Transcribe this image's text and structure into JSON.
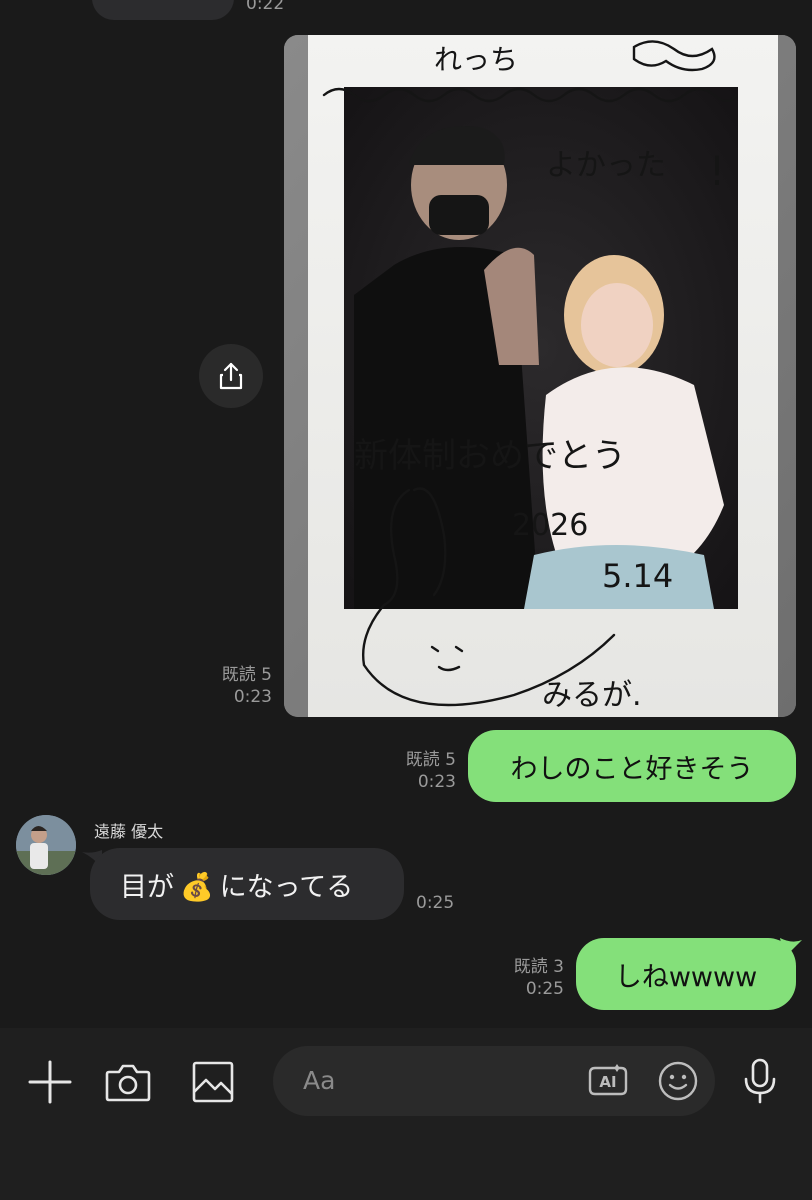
{
  "previous": {
    "time": "0:22"
  },
  "photo_message": {
    "read_receipt": "既読 5",
    "time": "0:23",
    "handwriting": {
      "top": "れっち",
      "middle": "よかった！",
      "center": "新体制おめでとう",
      "year": "2026",
      "date": "5.14",
      "signature": "みるが."
    }
  },
  "messages": [
    {
      "type": "sent",
      "read_receipt": "既読 5",
      "time": "0:23",
      "text": "わしのこと好きそう"
    },
    {
      "type": "received",
      "sender": "遠藤 優太",
      "time": "0:25",
      "text_before": "目が",
      "emoji": "💰",
      "text_after": "になってる"
    },
    {
      "type": "sent",
      "read_receipt": "既読 3",
      "time": "0:25",
      "text": "しねwwww"
    }
  ],
  "composer": {
    "placeholder": "Aa",
    "ai_label": "AI"
  },
  "icons": [
    "share-icon",
    "plus-icon",
    "camera-icon",
    "image-icon",
    "ai-icon",
    "emoji-icon",
    "microphone-icon"
  ],
  "colors": {
    "background": "#1a1a1a",
    "sent_bubble": "#84e07a",
    "received_bubble": "#2c2c2e",
    "meta_text": "#9a9a9a"
  }
}
